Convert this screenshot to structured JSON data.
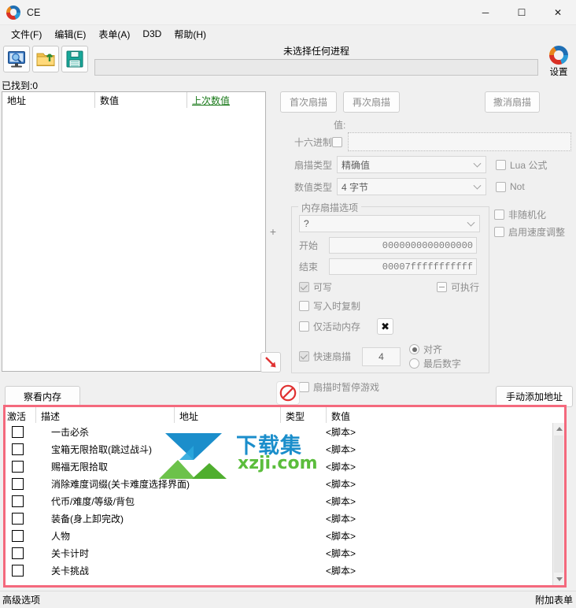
{
  "window": {
    "title": "CE",
    "logo_icon": "ce-swirl-icon",
    "minimize_label": "─",
    "maximize_label": "☐",
    "close_label": "✕"
  },
  "menu": {
    "items": [
      {
        "label": "文件(F)",
        "name": "menu-file"
      },
      {
        "label": "编辑(E)",
        "name": "menu-edit"
      },
      {
        "label": "表单(A)",
        "name": "menu-table"
      },
      {
        "label": "D3D",
        "name": "menu-d3d"
      },
      {
        "label": "帮助(H)",
        "name": "menu-help"
      }
    ]
  },
  "toolbar": {
    "icons": [
      {
        "name": "process-select-icon",
        "glyph": "monitor-magnifier"
      },
      {
        "name": "open-file-icon",
        "glyph": "folder-up"
      },
      {
        "name": "save-file-icon",
        "glyph": "floppy-disk"
      }
    ],
    "process_label": "未选择任何进程",
    "process_value": "",
    "settings_label": "设置",
    "settings_icon": "ce-swirl-icon"
  },
  "found": {
    "label": "已找到:0"
  },
  "results": {
    "columns": [
      {
        "label": "地址",
        "name": "result-col-address"
      },
      {
        "label": "数值",
        "name": "result-col-value"
      },
      {
        "label": "上次数值",
        "name": "result-col-previous"
      }
    ],
    "rows": []
  },
  "scan": {
    "first_scan_label": "首次扇描",
    "next_scan_label": "再次扇描",
    "undo_scan_label": "撒消扇描",
    "value_label": "值:",
    "value_input": "",
    "hex_label": "十六进制",
    "hex_checked": false,
    "scan_type_label": "扇描类型",
    "scan_type_value": "精确值",
    "value_type_label": "数值类型",
    "value_type_value": "4 字节",
    "lua_label": "Lua 公式",
    "lua_checked": false,
    "not_label": "Not",
    "not_checked": false,
    "unrandomize_label": "非随机化",
    "unrandomize_checked": false,
    "speedhack_label": "启用速度调整",
    "speedhack_checked": false
  },
  "memscan": {
    "group_title": "内存扇描选项",
    "region_value": "?",
    "start_label": "开始",
    "start_value": "0000000000000000",
    "stop_label": "结束",
    "stop_value": "00007fffffffffff",
    "writable_label": "可写",
    "writable_checked": true,
    "executable_label": "可执行",
    "executable_state": "dash",
    "copyonwrite_label": "写入时复制",
    "copyonwrite_checked": false,
    "active_mem_label": "仅活动内存",
    "active_mem_checked": false,
    "x_button_label": "✖",
    "fast_scan_label": "快速扇描",
    "fast_scan_checked": true,
    "fast_scan_value": "4",
    "align_label": "对齐",
    "align_selected": true,
    "lastdigits_label": "最后数字",
    "lastdigits_selected": false,
    "pause_label": "扇描时暂停游戏",
    "pause_checked": false
  },
  "tools": {
    "arrow_icon": "red-diagonal-arrow-icon",
    "prohibit_icon": "red-prohibit-icon",
    "splitter_icon": "cross-splitter-icon"
  },
  "midbar": {
    "view_memory_label": "察看内存",
    "add_address_label": "手动添加地址"
  },
  "cheat_table": {
    "columns": [
      {
        "label": "激活",
        "name": "table-col-active"
      },
      {
        "label": "描述",
        "name": "table-col-description"
      },
      {
        "label": "地址",
        "name": "table-col-address"
      },
      {
        "label": "类型",
        "name": "table-col-type"
      },
      {
        "label": "数值",
        "name": "table-col-value"
      }
    ],
    "rows": [
      {
        "active": false,
        "description": "一击必杀",
        "address": "",
        "type": "",
        "value": "<脚本>"
      },
      {
        "active": false,
        "description": "宝箱无限拾取(跳过战斗)",
        "address": "",
        "type": "",
        "value": "<脚本>"
      },
      {
        "active": false,
        "description": "赐福无限拾取",
        "address": "",
        "type": "",
        "value": "<脚本>"
      },
      {
        "active": false,
        "description": "消除难度词缀(关卡难度选择界面)",
        "address": "",
        "type": "",
        "value": "<脚本>"
      },
      {
        "active": false,
        "description": "代币/难度/等级/背包",
        "address": "",
        "type": "",
        "value": "<脚本>"
      },
      {
        "active": false,
        "description": "装备(身上卸完改)",
        "address": "",
        "type": "",
        "value": "<脚本>"
      },
      {
        "active": false,
        "description": "人物",
        "address": "",
        "type": "",
        "value": "<脚本>"
      },
      {
        "active": false,
        "description": "关卡计时",
        "address": "",
        "type": "",
        "value": "<脚本>"
      },
      {
        "active": false,
        "description": "关卡挑战",
        "address": "",
        "type": "",
        "value": "<脚本>"
      }
    ],
    "scrollbar": {
      "up_icon": "scroll-up-arrow-icon",
      "down_icon": "scroll-down-arrow-icon"
    },
    "highlight_color": "#f4697d"
  },
  "watermark": {
    "text": "下载集",
    "url": "xzji.com",
    "logo_icon": "download-arrow-mountain-icon",
    "blue": "#1b8ecb",
    "green": "#5bbd3c"
  },
  "statusbar": {
    "advanced_label": "高级选项",
    "extra_label": "附加表单"
  }
}
